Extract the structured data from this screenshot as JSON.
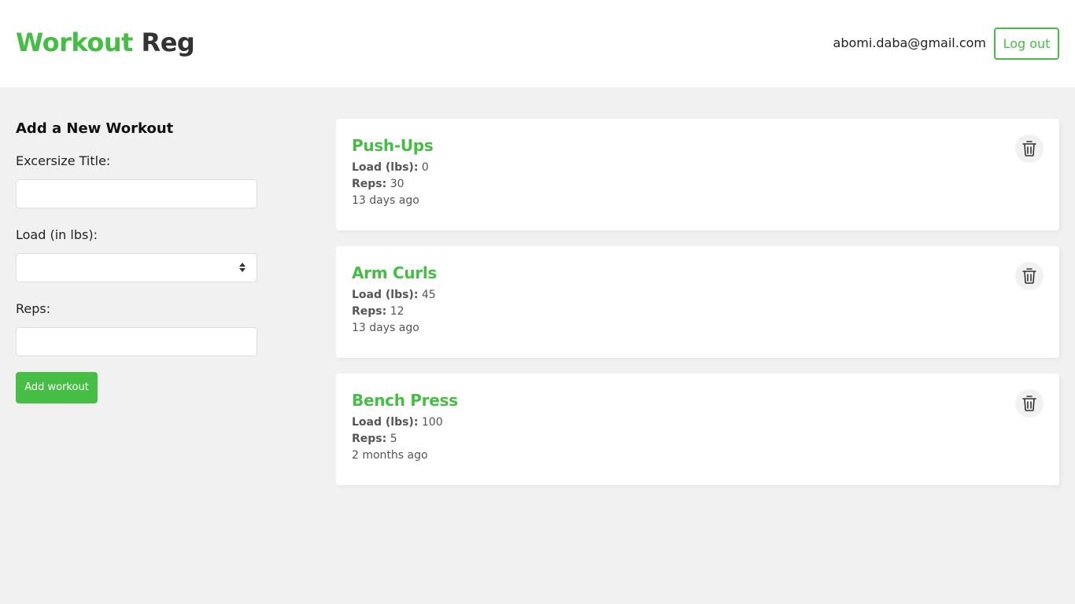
{
  "header": {
    "logo_accent": "Workout",
    "logo_rest": "Reg",
    "user_email": "abomi.daba@gmail.com",
    "logout_label": "Log out"
  },
  "form": {
    "heading": "Add a New Workout",
    "title_label": "Excersize Title:",
    "title_value": "",
    "load_label": "Load (in lbs):",
    "load_value": "",
    "reps_label": "Reps:",
    "reps_value": "",
    "submit_label": "Add workout"
  },
  "workouts": [
    {
      "title": "Push-Ups",
      "load_label": "Load (lbs):",
      "load": "0",
      "reps_label": "Reps:",
      "reps": "30",
      "time": "13 days ago"
    },
    {
      "title": "Arm Curls",
      "load_label": "Load (lbs):",
      "load": "45",
      "reps_label": "Reps:",
      "reps": "12",
      "time": "13 days ago"
    },
    {
      "title": "Bench Press",
      "load_label": "Load (lbs):",
      "load": "100",
      "reps_label": "Reps:",
      "reps": "5",
      "time": "2 months ago"
    }
  ],
  "colors": {
    "accent": "#46be46",
    "background": "#f1f1f1",
    "card": "#ffffff"
  },
  "icons": {
    "delete": "trash-icon",
    "number_spinner": "spinner-icon"
  }
}
